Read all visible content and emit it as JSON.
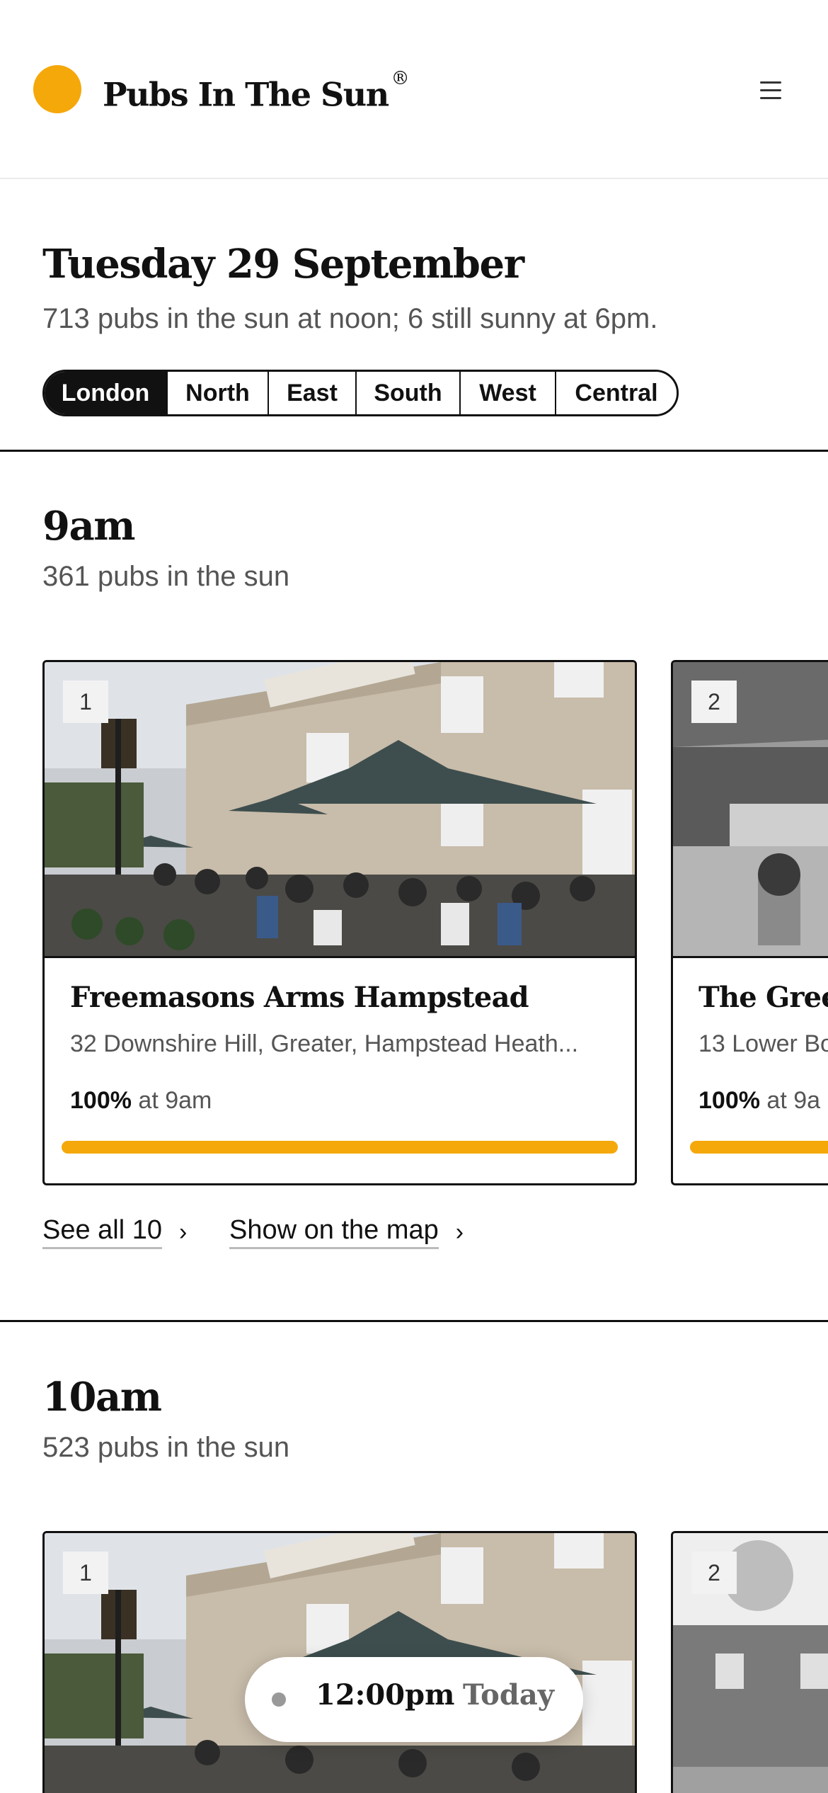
{
  "header": {
    "brand": "Pubs In The Sun",
    "registered": "®",
    "menu_icon": "hamburger-menu-icon",
    "sun_color": "#f5a80a"
  },
  "date": {
    "title": "Tuesday 29 September",
    "subtitle": "713 pubs in the sun at noon; 6 still sunny at 6pm."
  },
  "regions": [
    {
      "label": "London",
      "active": true
    },
    {
      "label": "North",
      "active": false
    },
    {
      "label": "East",
      "active": false
    },
    {
      "label": "South",
      "active": false
    },
    {
      "label": "West",
      "active": false
    },
    {
      "label": "Central",
      "active": false
    }
  ],
  "sections": [
    {
      "title": "9am",
      "subtitle": "361 pubs in the sun",
      "cards": [
        {
          "rank": "1",
          "name": "Freemasons Arms Hampstead",
          "address": "32 Downshire Hill, Greater, Hampstead Heath...",
          "percent": "100%",
          "at": "at 9am",
          "fill": 1.0
        },
        {
          "rank": "2",
          "name": "The Green",
          "address": "13 Lower Bo",
          "percent": "100%",
          "at": "at 9a",
          "fill": 1.0
        }
      ],
      "see_all": "See all 10",
      "map_link": "Show on the map"
    },
    {
      "title": "10am",
      "subtitle": "523 pubs in the sun",
      "cards": [
        {
          "rank": "1"
        },
        {
          "rank": "2"
        }
      ]
    }
  ],
  "time_picker": {
    "time": "12:00pm",
    "day": "Today"
  }
}
